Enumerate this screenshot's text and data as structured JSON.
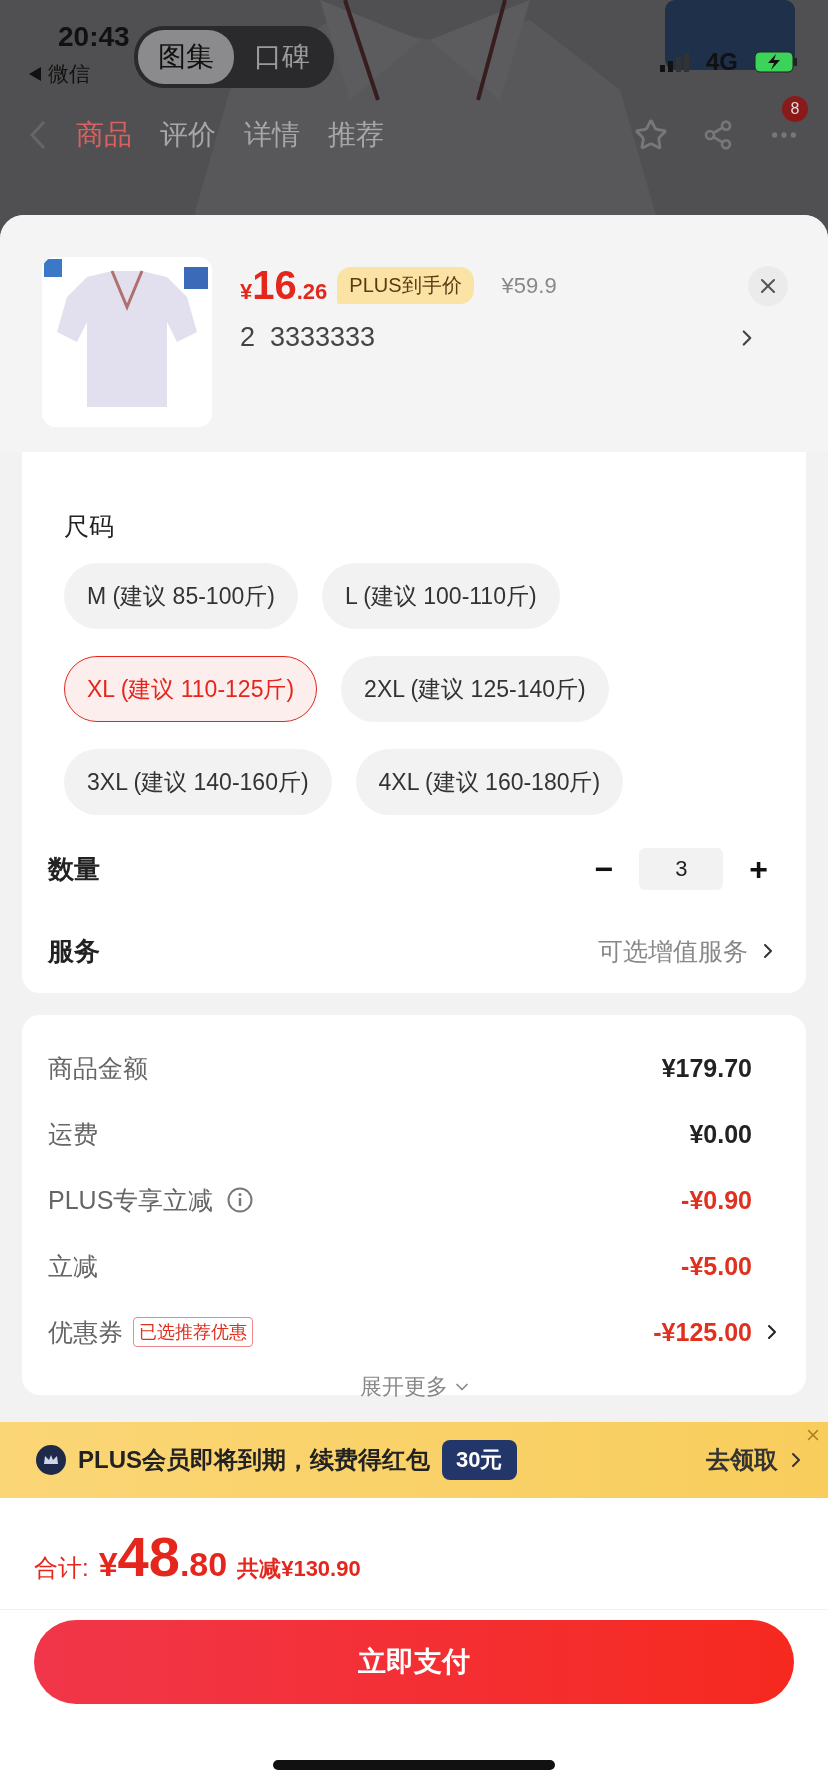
{
  "status_bar": {
    "time": "20:43",
    "back_label": "微信",
    "network": "4G"
  },
  "view_switch": [
    {
      "label": "图集",
      "selected": true
    },
    {
      "label": "口碑",
      "selected": false
    }
  ],
  "nav_tabs": [
    {
      "label": "商品",
      "selected": true
    },
    {
      "label": "评价",
      "selected": false
    },
    {
      "label": "详情",
      "selected": false
    },
    {
      "label": "推荐",
      "selected": false
    }
  ],
  "nav_badge": "8",
  "product": {
    "currency": "¥",
    "price_int": "16",
    "price_dec": ".26",
    "plus_tag": "PLUS到手价",
    "original_price": "¥59.9",
    "spec": "2  3333333"
  },
  "size": {
    "title": "尺码",
    "options": [
      {
        "label": "M (建议 85-100斤)",
        "selected": false
      },
      {
        "label": "L (建议 100-110斤)",
        "selected": false
      },
      {
        "label": "XL (建议 110-125斤)",
        "selected": true
      },
      {
        "label": "2XL (建议 125-140斤)",
        "selected": false
      },
      {
        "label": "3XL (建议 140-160斤)",
        "selected": false
      },
      {
        "label": "4XL (建议 160-180斤)",
        "selected": false
      }
    ]
  },
  "quantity": {
    "label": "数量",
    "minus": "−",
    "value": "3",
    "plus": "+"
  },
  "service": {
    "label": "服务",
    "value": "可选增值服务"
  },
  "breakdown": [
    {
      "label": "商品金额",
      "value": "¥179.70",
      "kind": "plain"
    },
    {
      "label": "运费",
      "value": "¥0.00",
      "kind": "plain"
    },
    {
      "label": "PLUS专享立减",
      "value": "-¥0.90",
      "kind": "discount",
      "info": true
    },
    {
      "label": "立减",
      "value": "-¥5.00",
      "kind": "discount"
    },
    {
      "label": "优惠券",
      "tag": "已选推荐优惠",
      "value": "-¥125.00",
      "kind": "discount",
      "link": true
    }
  ],
  "expand": "展开更多",
  "banner": {
    "text": "PLUS会员即将到期，续费得红包",
    "amount": "30元",
    "action": "去领取"
  },
  "total": {
    "label": "合计:",
    "currency": "¥",
    "int": "48",
    "dec": ".80",
    "saved": "共减¥130.90"
  },
  "pay_button": "立即支付"
}
